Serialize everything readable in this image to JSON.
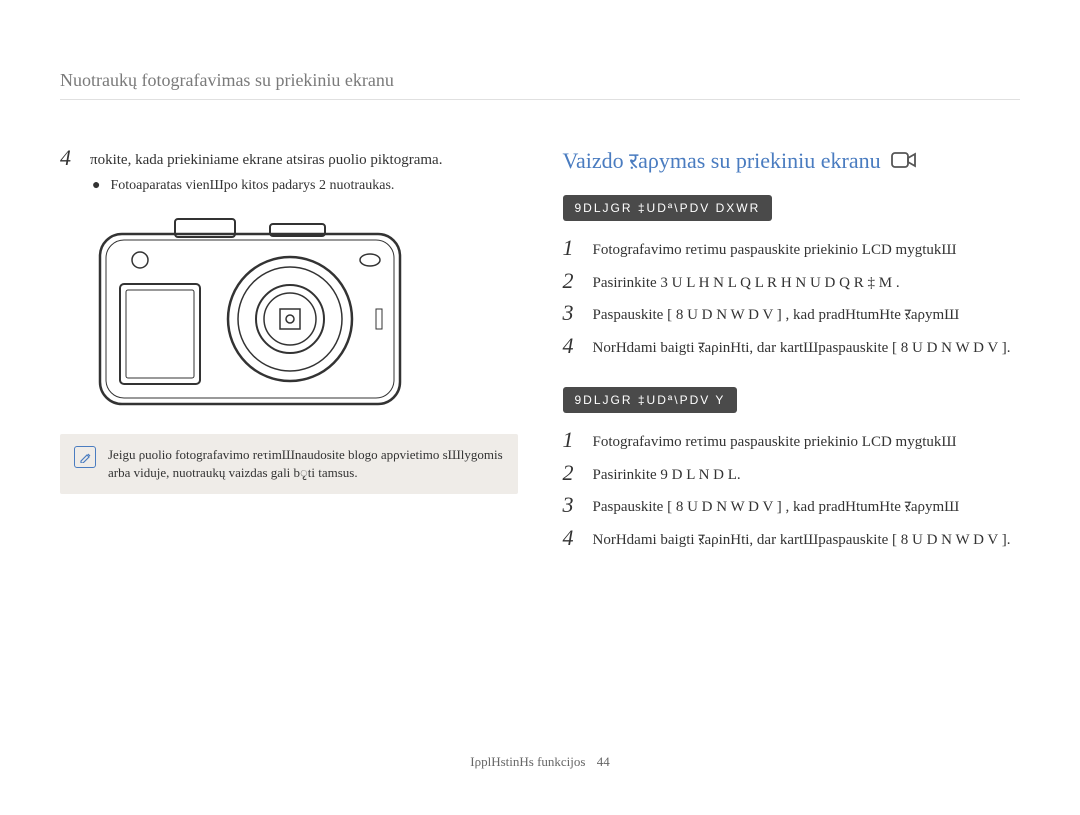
{
  "header": "Nuotraukų fotografavimas su priekiniu ekranu",
  "left": {
    "step4": {
      "num": "4",
      "text": "πokite, kada priekiniame ekrane atsiras ρuolio piktograma.",
      "sub": "Fotoaparatas vienШpo kitos padarys 2 nuotraukas."
    },
    "note": "Jeigu ρuolio fotografavimo reτimШnaudosite blogo apρvietimo sШlygomis arba viduje, nuotraukų vaizdas gali bृti tamsus."
  },
  "right": {
    "title": "Vaizdo ऱaρymas su priekiniu ekranu",
    "section1": {
      "bar": "9DLJGR ‡UDª\\PDV DXWR",
      "steps": [
        {
          "num": "1",
          "text": "Fotografavimo reτimu paspauskite priekinio LCD mygtukШ"
        },
        {
          "num": "2",
          "text": "Pasirinkite  3 U L H N L Q L R   H N U D Q R   ‡ M ."
        },
        {
          "num": "3",
          "text": "Paspauskite [ 8   U D N W D V ] , kad pradΗtumΗte ऱaρymШ"
        },
        {
          "num": "4",
          "text": "NorΗdami baigti ऱaρinΗti, dar kartШpaspauskite [ 8   U D N W D V ]."
        }
      ]
    },
    "section2": {
      "bar": "9DLJGR ‡UDª\\PDV Y",
      "steps": [
        {
          "num": "1",
          "text": "Fotografavimo reτimu paspauskite priekinio LCD mygtukШ"
        },
        {
          "num": "2",
          "text": "Pasirinkite  9 D L N D L."
        },
        {
          "num": "3",
          "text": "Paspauskite [ 8   U D N W D V ] , kad pradΗtumΗte ऱaρymШ"
        },
        {
          "num": "4",
          "text": "NorΗdami baigti ऱaρinΗti, dar kartШpaspauskite [ 8   U D N W D V ]."
        }
      ]
    }
  },
  "footer": {
    "label": "IρplΗstinΗs funkcijos",
    "page": "44"
  },
  "icons": {
    "note_glyph": "✎",
    "bullet": "●"
  }
}
